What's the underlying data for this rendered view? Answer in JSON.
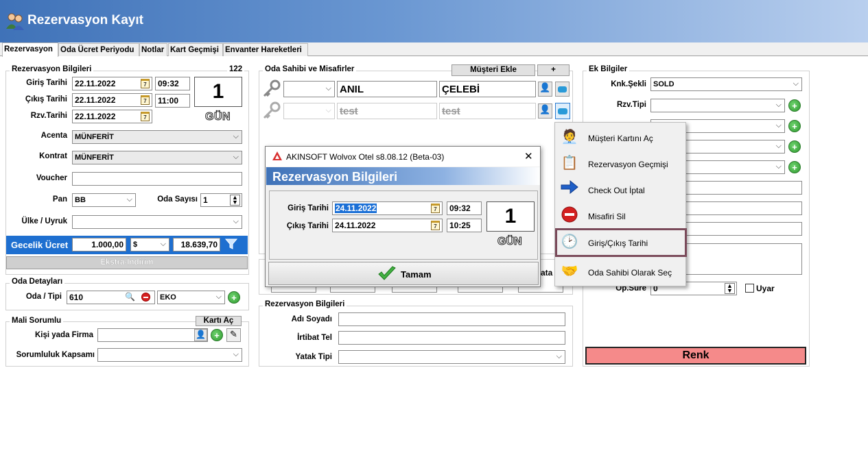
{
  "window": {
    "title": "Rezervasyon Kayıt"
  },
  "tabs": [
    "Rezervasyon",
    "Oda Ücret Periyodu",
    "Notlar",
    "Kart Geçmişi",
    "Envanter Hareketleri"
  ],
  "rez": {
    "section": "Rezervasyon Bilgileri",
    "count": "122",
    "giris_label": "Giriş Tarihi",
    "giris_date": "22.11.2022",
    "giris_time": "09:32",
    "cikis_label": "Çıkış Tarihi",
    "cikis_date": "22.11.2022",
    "cikis_time": "11:00",
    "rzv_label": "Rzv.Tarihi",
    "rzv_date": "22.11.2022",
    "days": "1",
    "days_unit": "GÜN",
    "acenta_label": "Acenta",
    "acenta": "MÜNFERİT",
    "kontrat_label": "Kontrat",
    "kontrat": "MÜNFERİT",
    "voucher_label": "Voucher",
    "voucher": "",
    "pan_label": "Pan",
    "pan": "BB",
    "oda_sayisi_label": "Oda Sayısı",
    "oda_sayisi": "1",
    "ulke_label": "Ülke / Uyruk",
    "ulke": "",
    "gecelik_label": "Gecelik Ücret",
    "gecelik": "1.000,00",
    "currency": "$",
    "total": "18.639,70",
    "extra": "Ekstra-İndirim"
  },
  "oda": {
    "section": "Oda Detayları",
    "label": "Oda / Tipi",
    "no": "610",
    "tip": "EKO"
  },
  "mali": {
    "section": "Mali Sorumlu",
    "kart_button": "Kartı Aç",
    "kisi_label": "Kişi yada Firma",
    "kisi": "",
    "kapsam_label": "Sorumluluk Kapsamı",
    "kapsam": ""
  },
  "guests": {
    "section": "Oda Sahibi ve Misafirler",
    "add_button": "Müşteri Ekle",
    "plus_button": "+",
    "rows": [
      {
        "first": "ANIL",
        "last": "ÇELEBİ"
      },
      {
        "first": "test",
        "last": "test"
      }
    ]
  },
  "rez2": {
    "section": "Rezervasyon Bilgileri",
    "adi_label": "Adı Soyadı",
    "adi": "",
    "irtibat_label": "İrtibat Tel",
    "irtibat": "",
    "yatak_label": "Yatak Tipi",
    "yatak": "",
    "partial_text": "ata"
  },
  "ek": {
    "section": "Ek Bilgiler",
    "knk_label": "Knk.Şekli",
    "knk": "SOLD",
    "rzv_tipi_label": "Rzv.Tipi",
    "rzv_tipi": "",
    "opsure_label": "Op.Süre",
    "opsure": "0",
    "uyar_label": "Uyar",
    "renk_button": "Renk"
  },
  "context_menu": {
    "items": [
      "Müşteri Kartını Aç",
      "Rezervasyon Geçmişi",
      "Check Out İptal",
      "Misafiri Sil",
      "Giriş/Çıkış Tarihi",
      "Oda Sahibi Olarak Seç"
    ],
    "highlight": "#7a4a5a"
  },
  "dialog": {
    "window_title": "AKINSOFT Wolvox Otel s8.08.12 (Beta-03)",
    "header": "Rezervasyon Bilgileri",
    "giris_label": "Giriş Tarihi",
    "giris_date": "24.11.2022",
    "giris_time": "09:32",
    "cikis_label": "Çıkış Tarihi",
    "cikis_date": "24.11.2022",
    "cikis_time": "10:25",
    "days": "1",
    "days_unit": "GÜN",
    "ok_button": "Tamam",
    "close": "✕"
  },
  "colors": {
    "title_bar": "#3f72b8",
    "gecelik_bar": "#1e6fd0",
    "renk": "#f58a8a",
    "selection": "#1a6fd6"
  }
}
